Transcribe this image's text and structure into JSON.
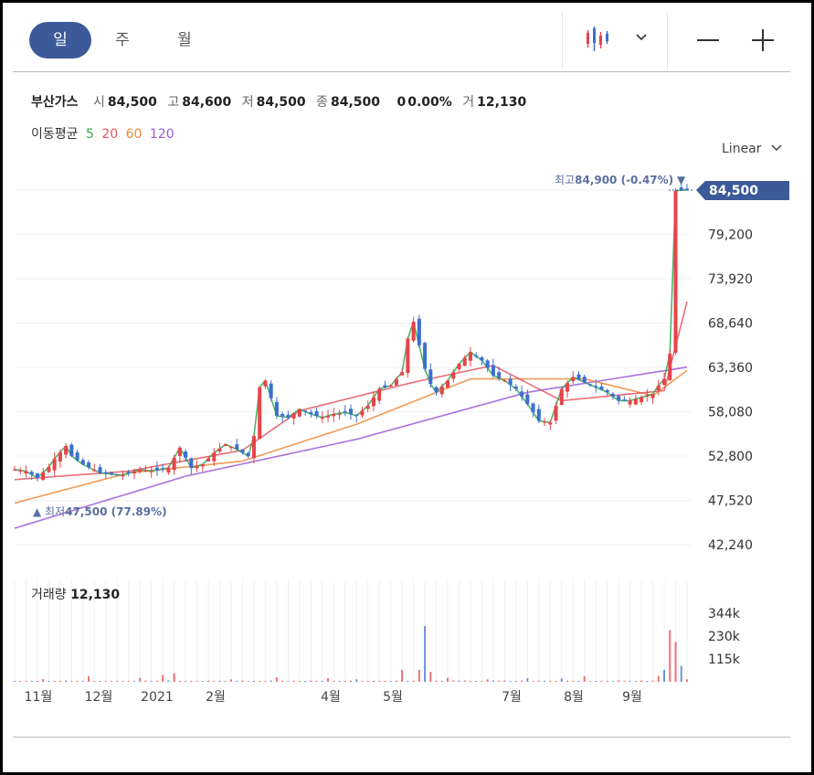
{
  "tabs": [
    {
      "label": "일",
      "active": true
    },
    {
      "label": "주",
      "active": false
    },
    {
      "label": "월",
      "active": false
    }
  ],
  "toolbar": {
    "chart_type_icon": "candlestick-icon",
    "dropdown_icon": "chevron-down-icon",
    "zoom_out_icon": "minus-icon",
    "zoom_in_icon": "plus-icon"
  },
  "quote": {
    "name": "부산가스",
    "open_label": "시",
    "open": "84,500",
    "high_label": "고",
    "high": "84,600",
    "low_label": "저",
    "low": "84,500",
    "close_label": "종",
    "close": "84,500",
    "change": "0",
    "change_pct": "0.00%",
    "volume_label": "거",
    "volume": "12,130"
  },
  "moving_average": {
    "label": "이동평균",
    "periods": [
      {
        "label": "5",
        "color": "#2fa84f"
      },
      {
        "label": "20",
        "color": "#e8555f"
      },
      {
        "label": "60",
        "color": "#f0883a"
      },
      {
        "label": "120",
        "color": "#9b59d6"
      }
    ]
  },
  "scale_selector": "Linear",
  "price_axis": {
    "ticks": [
      "79,200",
      "73,920",
      "68,640",
      "63,360",
      "58,080",
      "52,800",
      "47,520",
      "42,240"
    ],
    "current": "84,500"
  },
  "annotations": {
    "high": {
      "label": "최고",
      "value": "84,900",
      "pct": "(-0.47%)"
    },
    "low": {
      "label": "최저",
      "value": "47,500",
      "pct": "(77.89%)"
    }
  },
  "volume_panel": {
    "label": "거래량",
    "value": "12,130",
    "ticks": [
      "344k",
      "230k",
      "115k"
    ]
  },
  "time_axis": [
    "11월",
    "12월",
    "2021",
    "2월",
    "4월",
    "5월",
    "7월",
    "8월",
    "9월"
  ],
  "colors": {
    "up": "#e8434a",
    "down": "#3d6fd1",
    "accent": "#3c5a9a",
    "ma5": "#2fa84f",
    "ma20": "#e8555f",
    "ma60": "#f0883a",
    "ma120": "#9b59d6"
  },
  "chart_data": {
    "type": "candlestick",
    "yaxis": {
      "min": 42240,
      "max": 84500,
      "ticks": [
        79200,
        73920,
        68640,
        63360,
        58080,
        52800,
        47520,
        42240
      ]
    },
    "x": [
      "11월",
      "12월",
      "2021",
      "2월",
      "4월",
      "5월",
      "7월",
      "8월",
      "9월"
    ],
    "close_path": [
      [
        0,
        51200
      ],
      [
        2,
        51000
      ],
      [
        4,
        50200
      ],
      [
        6,
        51500
      ],
      [
        7,
        52500
      ],
      [
        9,
        54000
      ],
      [
        10,
        52800
      ],
      [
        12,
        51800
      ],
      [
        15,
        50800
      ],
      [
        19,
        50500
      ],
      [
        22,
        51200
      ],
      [
        24,
        51000
      ],
      [
        27,
        51400
      ],
      [
        29,
        53800
      ],
      [
        31,
        51400
      ],
      [
        33,
        51800
      ],
      [
        35,
        53200
      ],
      [
        37,
        54200
      ],
      [
        39,
        53600
      ],
      [
        41,
        52800
      ],
      [
        42,
        55200
      ],
      [
        43,
        61000
      ],
      [
        44,
        61800
      ],
      [
        46,
        57600
      ],
      [
        48,
        57400
      ],
      [
        50,
        58400
      ],
      [
        52,
        57800
      ],
      [
        54,
        57400
      ],
      [
        56,
        57800
      ],
      [
        58,
        58000
      ],
      [
        60,
        57600
      ],
      [
        62,
        58800
      ],
      [
        64,
        60800
      ],
      [
        66,
        61200
      ],
      [
        68,
        62800
      ],
      [
        69,
        66800
      ],
      [
        70,
        68800
      ],
      [
        71,
        66000
      ],
      [
        72,
        63200
      ],
      [
        73,
        61400
      ],
      [
        74,
        60400
      ],
      [
        76,
        61800
      ],
      [
        78,
        63800
      ],
      [
        80,
        65200
      ],
      [
        82,
        64200
      ],
      [
        84,
        62400
      ],
      [
        86,
        61800
      ],
      [
        88,
        60800
      ],
      [
        90,
        59000
      ],
      [
        92,
        57000
      ],
      [
        94,
        56800
      ],
      [
        96,
        60800
      ],
      [
        98,
        62200
      ],
      [
        100,
        61600
      ],
      [
        102,
        61000
      ],
      [
        104,
        60400
      ],
      [
        106,
        59400
      ],
      [
        108,
        59400
      ],
      [
        110,
        59800
      ],
      [
        112,
        60200
      ],
      [
        113,
        61200
      ],
      [
        114,
        62000
      ],
      [
        115,
        65000
      ],
      [
        116,
        84400
      ],
      [
        117,
        84500
      ],
      [
        118,
        84500
      ]
    ],
    "ma120": [
      [
        0,
        44200
      ],
      [
        30,
        50400
      ],
      [
        60,
        54800
      ],
      [
        90,
        60400
      ],
      [
        118,
        63400
      ]
    ],
    "ma60": [
      [
        0,
        47200
      ],
      [
        20,
        50800
      ],
      [
        40,
        52200
      ],
      [
        60,
        56600
      ],
      [
        80,
        62000
      ],
      [
        100,
        62000
      ],
      [
        112,
        60000
      ],
      [
        118,
        63000
      ]
    ],
    "ma20": [
      [
        0,
        50000
      ],
      [
        20,
        51000
      ],
      [
        40,
        53500
      ],
      [
        50,
        58200
      ],
      [
        70,
        61600
      ],
      [
        84,
        63600
      ],
      [
        96,
        59400
      ],
      [
        108,
        60200
      ],
      [
        114,
        60600
      ],
      [
        118,
        71200
      ]
    ],
    "volume": [
      [
        5,
        14000
      ],
      [
        13,
        28000
      ],
      [
        22,
        20000
      ],
      [
        26,
        34000
      ],
      [
        28,
        42000
      ],
      [
        38,
        12000
      ],
      [
        46,
        22000
      ],
      [
        55,
        18000
      ],
      [
        60,
        12000
      ],
      [
        68,
        60000
      ],
      [
        71,
        60000
      ],
      [
        72,
        280000
      ],
      [
        73,
        50000
      ],
      [
        76,
        20000
      ],
      [
        83,
        12000
      ],
      [
        90,
        18000
      ],
      [
        96,
        16000
      ],
      [
        100,
        28000
      ],
      [
        113,
        30000
      ],
      [
        114,
        60000
      ],
      [
        115,
        260000
      ],
      [
        116,
        200000
      ],
      [
        117,
        80000
      ],
      [
        118,
        12130
      ]
    ],
    "volume_max": 344000,
    "high": 84900,
    "low": 47500
  }
}
